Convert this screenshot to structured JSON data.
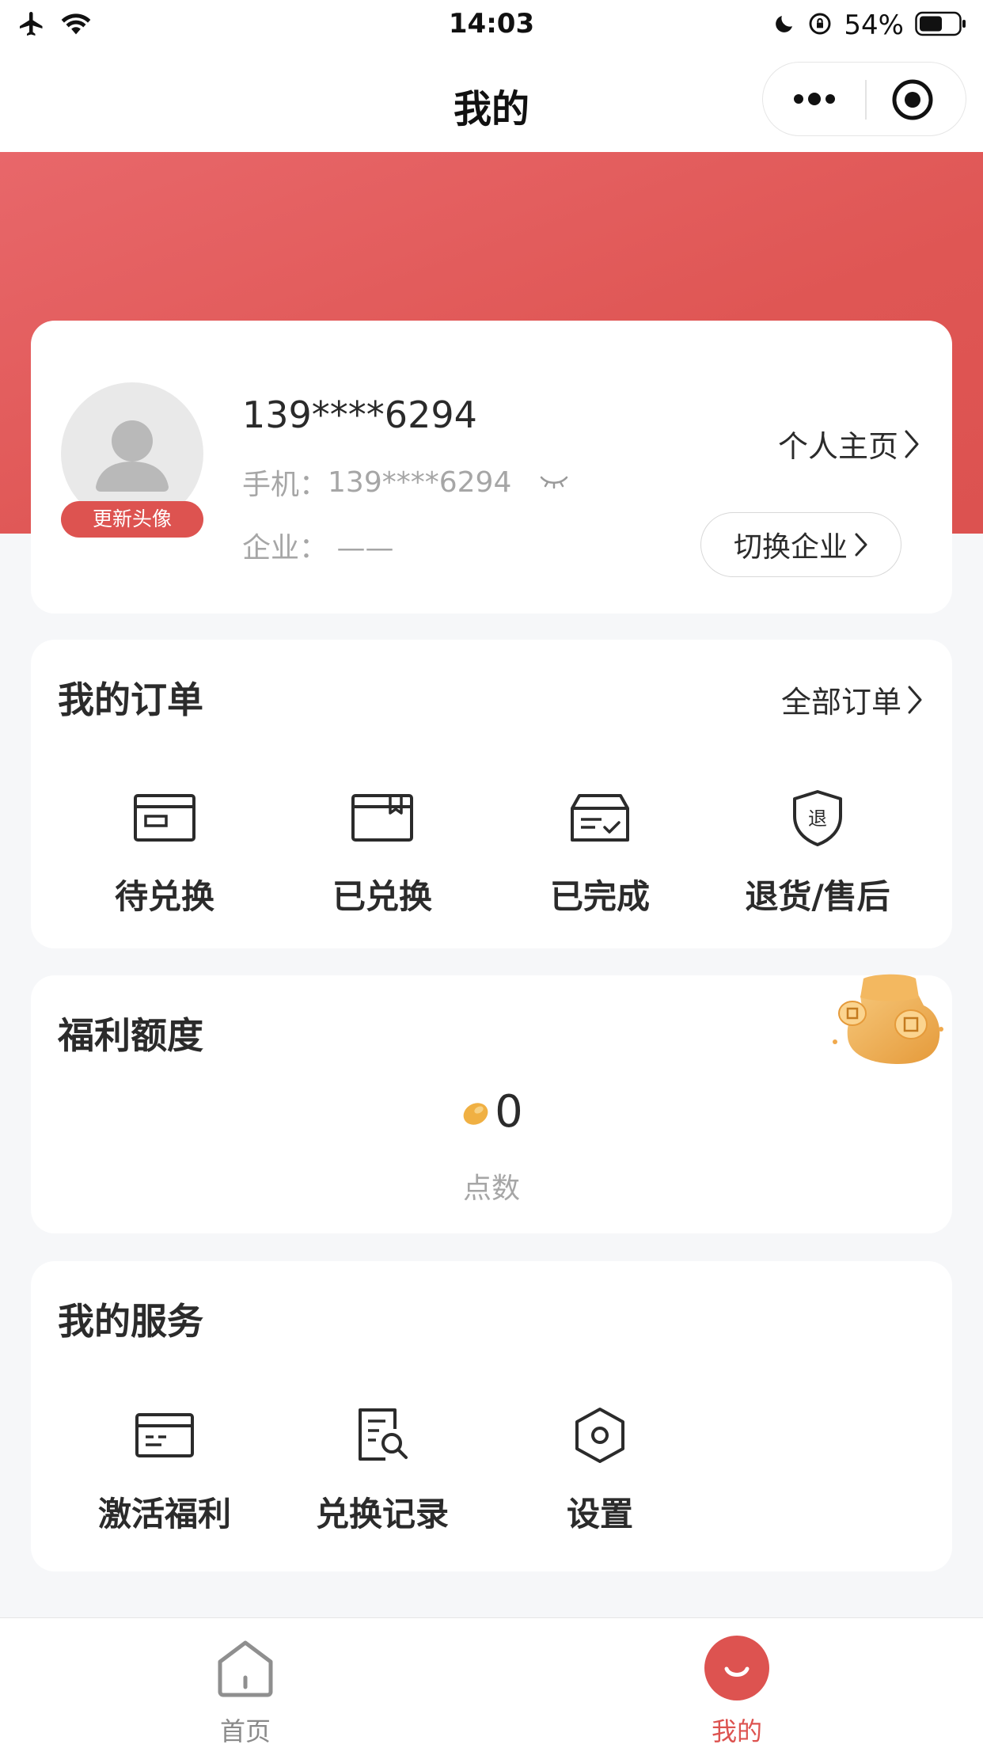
{
  "status_bar": {
    "time": "14:03",
    "battery": "54%"
  },
  "nav": {
    "title": "我的"
  },
  "profile": {
    "name": "139****6294",
    "update_avatar": "更新头像",
    "phone_label": "手机：",
    "phone": "139****6294",
    "company_label": "企业：",
    "company": "——",
    "homepage": "个人主页",
    "switch_company": "切换企业"
  },
  "orders": {
    "title": "我的订单",
    "all": "全部订单",
    "items": [
      {
        "label": "待兑换",
        "icon": "card-icon"
      },
      {
        "label": "已兑换",
        "icon": "box-icon"
      },
      {
        "label": "已完成",
        "icon": "inbox-check-icon"
      },
      {
        "label": "退货/售后",
        "icon": "shield-return-icon",
        "glyph": "退"
      }
    ]
  },
  "welfare": {
    "title": "福利额度",
    "points": "0",
    "points_label": "点数",
    "icon": "money-bag-icon"
  },
  "services": {
    "title": "我的服务",
    "items": [
      {
        "label": "激活福利",
        "icon": "card-activate-icon"
      },
      {
        "label": "兑换记录",
        "icon": "record-search-icon"
      },
      {
        "label": "设置",
        "icon": "settings-hexagon-icon"
      }
    ]
  },
  "tabbar": {
    "items": [
      {
        "label": "首页",
        "icon": "home-icon",
        "active": false
      },
      {
        "label": "我的",
        "icon": "smile-icon",
        "active": true
      }
    ]
  },
  "colors": {
    "accent": "#dd5350",
    "background": "#f6f7f9",
    "card": "#ffffff",
    "muted_text": "#a6a6a6"
  }
}
